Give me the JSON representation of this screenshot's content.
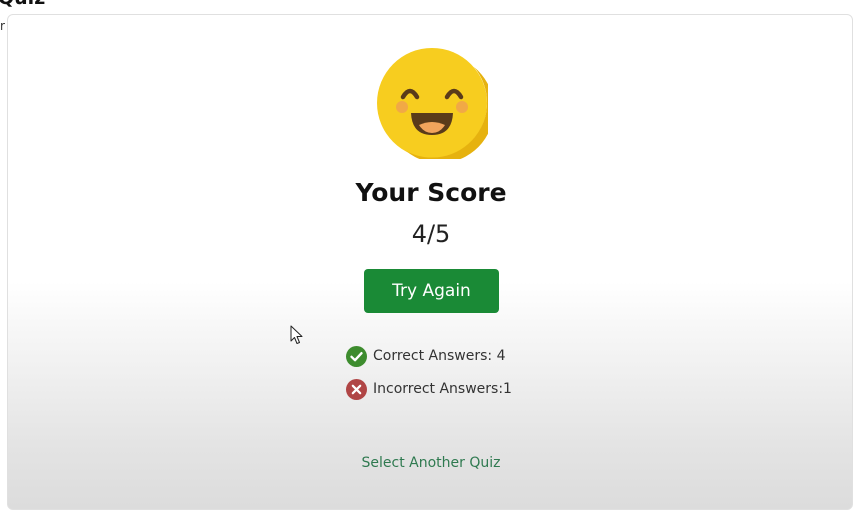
{
  "header": {
    "title": "Quiz",
    "side_glyph": "r"
  },
  "result": {
    "icon": "smiling-face-icon",
    "score_label": "Your Score",
    "score_value": "4/5",
    "score_correct": 4,
    "score_total": 5,
    "try_again_label": "Try Again",
    "correct_text": "Correct Answers: 4",
    "incorrect_text": "Incorrect Answers:1",
    "select_another_label": "Select Another Quiz"
  },
  "colors": {
    "button_green": "#1a8a36",
    "correct_green": "#3d8c2e",
    "incorrect_red": "#b04545",
    "link_green": "#2f7a50",
    "emoji_yellow": "#f7cd1f"
  }
}
